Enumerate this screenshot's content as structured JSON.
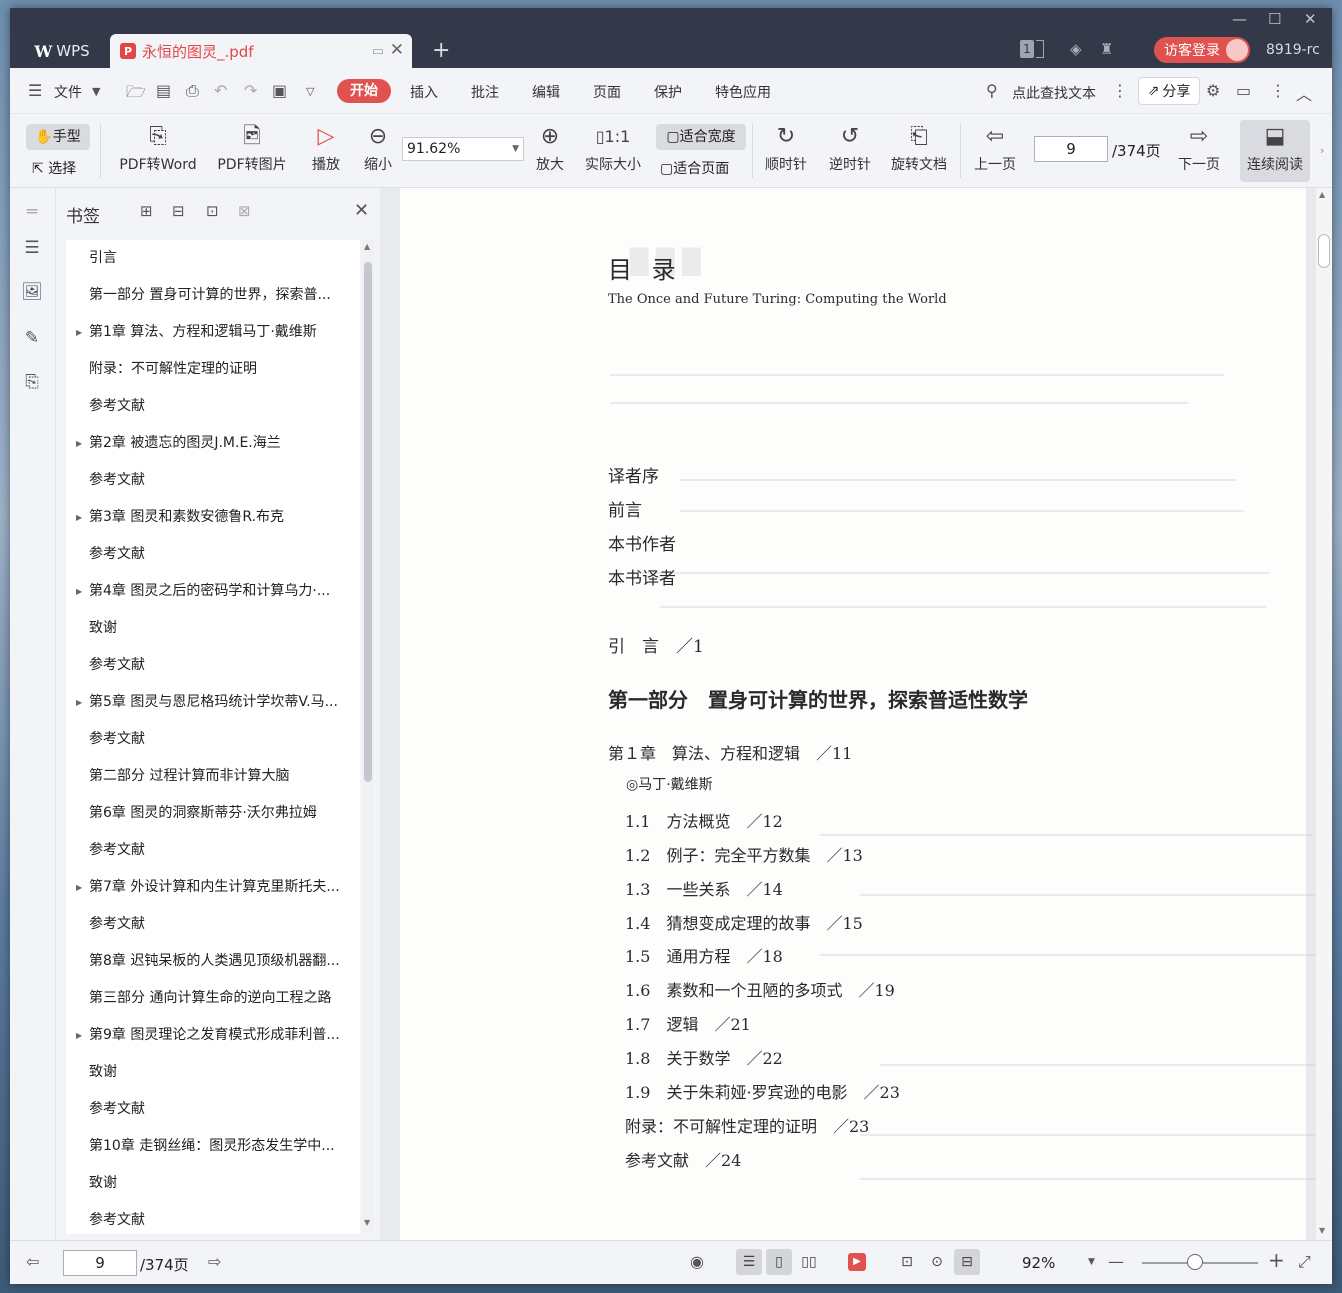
{
  "app": {
    "wps_label": "WPS",
    "doc_tab": "永恒的图灵_.pdf",
    "visitor_login": "访客登录",
    "user_id": "8919-rc",
    "badge_num": "1"
  },
  "menu": {
    "file": "文件",
    "items": [
      "开始",
      "插入",
      "批注",
      "编辑",
      "页面",
      "保护",
      "特色应用"
    ],
    "search": "点此查找文本",
    "share": "分享"
  },
  "toolbar": {
    "hand": "手型",
    "select": "选择",
    "pdf_to_word": "PDF转Word",
    "pdf_to_image": "PDF转图片",
    "play": "播放",
    "zoom_out": "缩小",
    "zoom_value": "91.62%",
    "zoom_in": "放大",
    "actual_size": "实际大小",
    "fit_width": "适合宽度",
    "fit_page": "适合页面",
    "clockwise": "顺时针",
    "counterclockwise": "逆时针",
    "rotate_doc": "旋转文档",
    "prev_page": "上一页",
    "page_current": "9",
    "page_total": "/374页",
    "next_page": "下一页",
    "continuous": "连续阅读"
  },
  "bookmarks": {
    "title": "书签",
    "items": [
      {
        "label": "引言",
        "expand": false
      },
      {
        "label": "第一部分 置身可计算的世界，探索普...",
        "expand": false
      },
      {
        "label": "第1章 算法、方程和逻辑马丁·戴维斯",
        "expand": true
      },
      {
        "label": "附录：不可解性定理的证明",
        "expand": false
      },
      {
        "label": "参考文献",
        "expand": false
      },
      {
        "label": "第2章 被遗忘的图灵J.M.E.海兰",
        "expand": true
      },
      {
        "label": "参考文献",
        "expand": false
      },
      {
        "label": "第3章 图灵和素数安德鲁R.布克",
        "expand": true
      },
      {
        "label": "参考文献",
        "expand": false
      },
      {
        "label": "第4章 图灵之后的密码学和计算乌力·...",
        "expand": true
      },
      {
        "label": "致谢",
        "expand": false
      },
      {
        "label": "参考文献",
        "expand": false
      },
      {
        "label": "第5章 图灵与恩尼格玛统计学坎蒂V.马...",
        "expand": true
      },
      {
        "label": "参考文献",
        "expand": false
      },
      {
        "label": "第二部分 过程计算而非计算大脑",
        "expand": false
      },
      {
        "label": "第6章 图灵的洞察斯蒂芬·沃尔弗拉姆",
        "expand": false
      },
      {
        "label": "参考文献",
        "expand": false
      },
      {
        "label": "第7章 外设计算和内生计算克里斯托夫...",
        "expand": true
      },
      {
        "label": "参考文献",
        "expand": false
      },
      {
        "label": "第8章 迟钝呆板的人类遇见顶级机器翻...",
        "expand": false
      },
      {
        "label": "第三部分 通向计算生命的逆向工程之路",
        "expand": false
      },
      {
        "label": "第9章 图灵理论之发育模式形成菲利普...",
        "expand": true
      },
      {
        "label": "致谢",
        "expand": false
      },
      {
        "label": "参考文献",
        "expand": false
      },
      {
        "label": "第10章 走钢丝绳：图灵形态发生学中...",
        "expand": false
      },
      {
        "label": "致谢",
        "expand": false
      },
      {
        "label": "参考文献",
        "expand": false
      }
    ]
  },
  "page": {
    "title": "目 录",
    "subtitle": "The Once and Future Turing: Computing the World",
    "front_matter": [
      "译者序",
      "前言",
      "本书作者",
      "本书译者"
    ],
    "intro": "引　言　／1",
    "part1": "第一部分　置身可计算的世界，探索普适性数学",
    "chapter1": "第１章　算法、方程和逻辑　／11",
    "author": "◎马丁·戴维斯",
    "sections": [
      "1.1　方法概览　／12",
      "1.2　例子：完全平方数集　／13",
      "1.3　一些关系　／14",
      "1.4　猜想变成定理的故事　／15",
      "1.5　通用方程　／18",
      "1.6　素数和一个丑陋的多项式　／19",
      "1.7　逻辑　／21",
      "1.8　关于数学　／22",
      "1.9　关于朱莉娅·罗宾逊的电影　／23"
    ],
    "appendix": "附录：不可解性定理的证明　／23",
    "references": "参考文献　／24"
  },
  "status": {
    "page_current": "9",
    "page_total": "/374页",
    "zoom": "92%",
    "zoom_fraction": 0.46
  }
}
